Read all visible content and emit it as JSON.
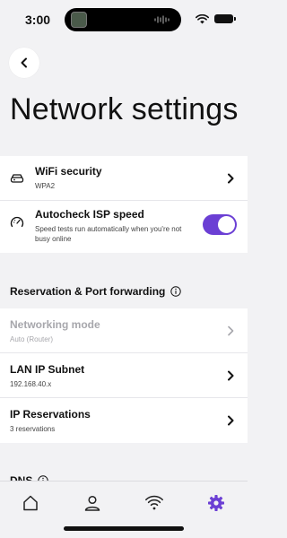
{
  "status_bar": {
    "time": "3:00"
  },
  "header": {
    "title": "Network settings",
    "back_icon": "chevron-left-icon"
  },
  "security_card": {
    "items": [
      {
        "icon": "router-icon",
        "title": "WiFi security",
        "subtitle": "WPA2"
      },
      {
        "icon": "speedometer-icon",
        "title": "Autocheck ISP speed",
        "subtitle": "Speed tests run automatically when you're not busy online",
        "toggle_on": true
      }
    ]
  },
  "reservation_section": {
    "title": "Reservation & Port forwarding",
    "items": [
      {
        "title": "Networking mode",
        "subtitle": "Auto (Router)",
        "disabled": true
      },
      {
        "title": "LAN IP Subnet",
        "subtitle": "192.168.40.x"
      },
      {
        "title": "IP Reservations",
        "subtitle": "3 reservations"
      }
    ]
  },
  "dns_section": {
    "title": "DNS"
  },
  "tab_bar": {
    "tabs": [
      {
        "icon": "home-icon",
        "active": false
      },
      {
        "icon": "user-icon",
        "active": false
      },
      {
        "icon": "wifi-icon",
        "active": false
      },
      {
        "icon": "gear-icon",
        "active": true
      }
    ]
  },
  "colors": {
    "accent": "#6b3fd4",
    "background": "#f2f2f4",
    "disabled_text": "#a7a7ac"
  }
}
